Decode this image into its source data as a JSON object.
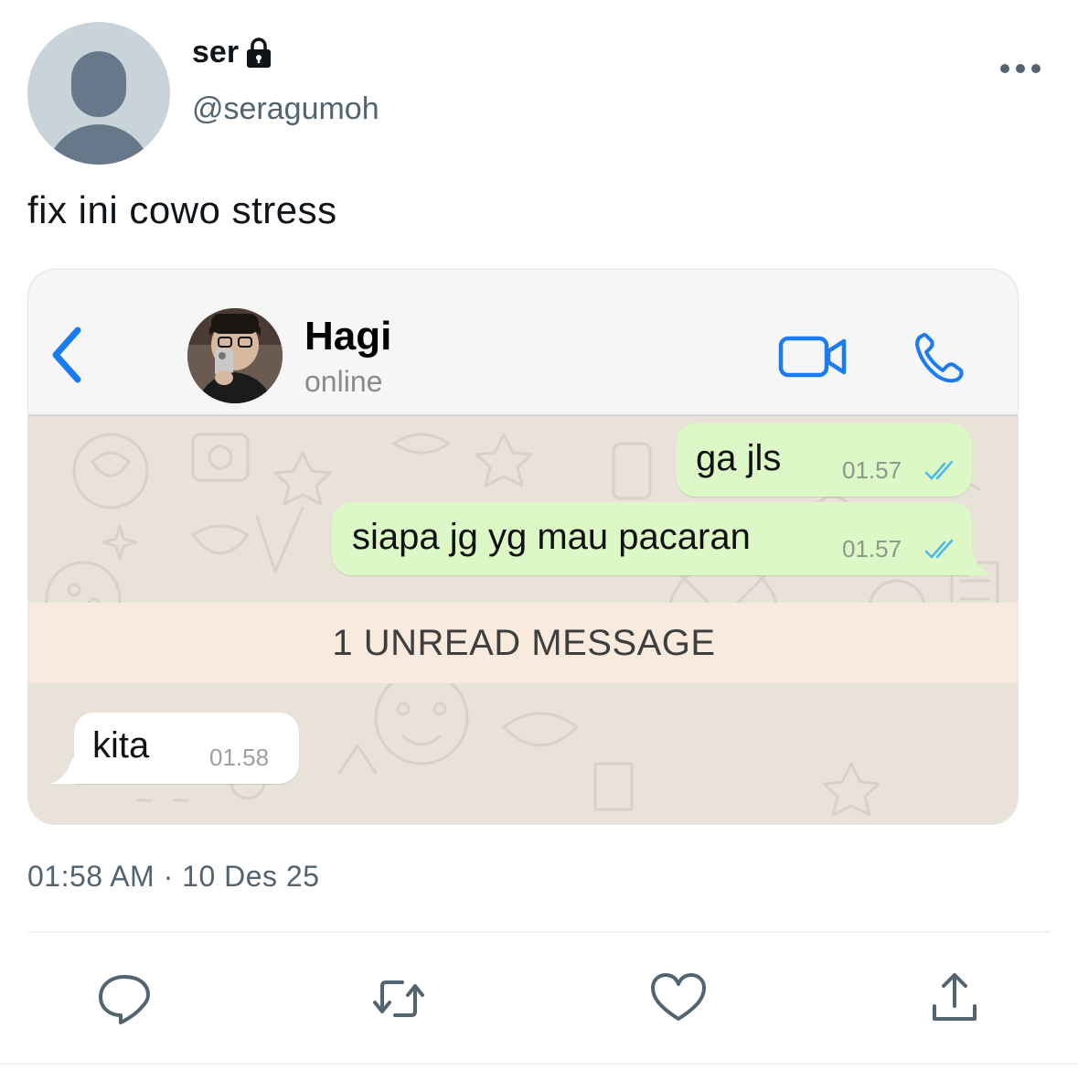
{
  "tweet": {
    "display_name": "ser",
    "handle": "@seragumoh",
    "text": "fix ini cowo stress",
    "timestamp": "01:58 AM · 10 Des 25",
    "icons": {
      "lock": "lock-icon",
      "more": "more-icon",
      "reply": "reply-icon",
      "retweet": "retweet-icon",
      "like": "like-icon",
      "share": "share-icon"
    }
  },
  "chat": {
    "contact_name": "Hagi",
    "contact_status": "online",
    "messages": [
      {
        "direction": "out",
        "text": "ga jls",
        "time": "01.57",
        "status": "read"
      },
      {
        "direction": "out",
        "text": "siapa jg yg mau pacaran",
        "time": "01.57",
        "status": "read"
      },
      {
        "direction": "in",
        "text": "kita",
        "time": "01.58"
      }
    ],
    "unread_banner": "1 UNREAD MESSAGE",
    "colors": {
      "outgoing_bubble": "#dcf8c6",
      "incoming_bubble": "#ffffff",
      "accent_blue": "#1a7bf2",
      "unread_banner": "#f8ebdd",
      "chat_background": "#e8e2d9"
    }
  },
  "colors": {
    "secondary_text": "#536471",
    "primary_text": "#0f1419"
  }
}
